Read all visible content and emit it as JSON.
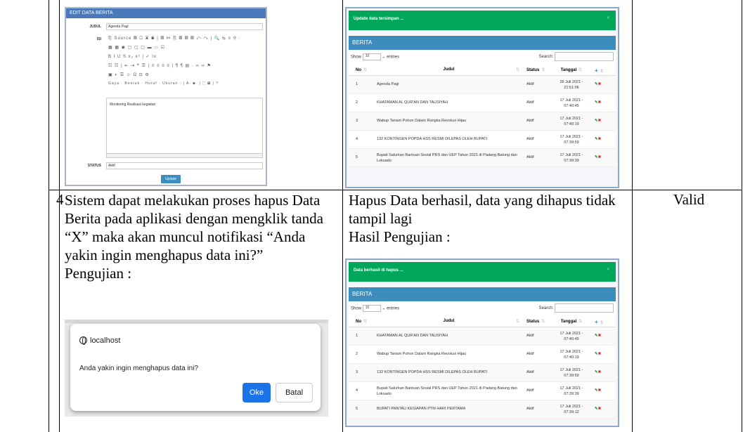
{
  "row4": {
    "number": "4",
    "description": "Sistem dapat melakukan proses hapus Data Berita pada aplikasi dengan mengklik tanda “X” maka akan muncul notifikasi “Anda yakin ingin menghapus data ini?”",
    "testing_label": "Pengujian :",
    "expected": "Hapus Data berhasil, data yang dihapus tidak tampil lagi",
    "result_label": "Hasil Pengujian :",
    "status": "Valid"
  },
  "editor": {
    "title": "EDIT DATA BERITA",
    "judul_label": "JUDUL",
    "judul_value": "Agenda Pagi",
    "isi_label": "ISI",
    "toolbar_row1": "⎘ Source  ▤ ▢ ▣ ◉ | ▤ ✂ ⎘ ▤ ▤ ▤ ↶ ↷ | 🔍 ⇆ ≡ ⚲ ·",
    "toolbar_row2": "▦ ▦ ◉ ▢ ▢ ▢ ▬ ▭ ☑",
    "toolbar_row3": "B  I  U  S  x₂  x²  | ✓  Ix",
    "toolbar_row4": "☷ ☷ | ⇤ ⇥ ❝ ☰ | ≡ ≡ ≡ ≡ | ¶ ¶ ▤ · ∞ ∞ ⚑",
    "toolbar_row5": "▣ ◐ ☰ ☺ Ω ⊡ ⚙",
    "toolbar_row6": "Gaya   ·  Bentuk  ·  Huruf  ·  Ukuran  · | A· ◙· | ⛶ ▤ | ?",
    "content": "Monitoring Realisasi kegiatan",
    "status_label": "STATUS",
    "status_value": "Aktif",
    "update_button": "Update"
  },
  "table_top": {
    "alert": "Update data tersimpan ...",
    "alert_close": "×",
    "box_title": "BERITA",
    "show_label": "Show",
    "show_value": "10",
    "entries_label": "entries",
    "search_label": "Search:",
    "headers": {
      "no": "No",
      "judul": "Judul",
      "status": "Status",
      "tanggal": "Tanggal",
      "add": "+"
    },
    "rows": [
      {
        "no": "1",
        "judul": "Agenda Pagi",
        "status": "Aktif",
        "tanggal": "26 Juli 2021 - 21:51:06"
      },
      {
        "no": "2",
        "judul": "KHATAMAN AL QUR'AN DAN TAUSIYAH",
        "status": "Aktif",
        "tanggal": "17 Juli 2021 - 07:40:45"
      },
      {
        "no": "3",
        "judul": "Wabup Tanam Pohon Dalam Rangka Revolusi Hijau",
        "status": "Aktif",
        "tanggal": "17 Juli 2021 - 07:40:19"
      },
      {
        "no": "4",
        "judul": "132 KONTINGEN POPDA HSS RESMI DILEPAS OLEH BUPATI",
        "status": "Aktif",
        "tanggal": "17 Juli 2021 - 07:39:59"
      },
      {
        "no": "5",
        "judul": "Bupati Salurkan Bantuan Sosial PRS dan UEP Tahun 2021 di Padang Batung dan Loksado",
        "status": "Aktif",
        "tanggal": "17 Juli 2021 - 07:39:39"
      }
    ]
  },
  "table_bottom": {
    "alert": "Data berhasil di hapus ...",
    "alert_close": "×",
    "box_title": "BERITA",
    "show_label": "Show",
    "show_value": "10",
    "entries_label": "entries",
    "search_label": "Search:",
    "headers": {
      "no": "No",
      "judul": "Judul",
      "status": "Status",
      "tanggal": "Tanggal",
      "add": "+"
    },
    "rows": [
      {
        "no": "1",
        "judul": "KHATAMAN AL QUR'AN DAN TAUSIYAH",
        "status": "Aktif",
        "tanggal": "17 Juli 2021 - 07:40:45"
      },
      {
        "no": "2",
        "judul": "Wabup Tanam Pohon Dalam Rangka Revolusi Hijau",
        "status": "Aktif",
        "tanggal": "17 Juli 2021 - 07:40:19"
      },
      {
        "no": "3",
        "judul": "132 KONTINGEN POPDA HSS RESMI DILEPAS OLEH BUPATI",
        "status": "Aktif",
        "tanggal": "17 Juli 2021 - 07:39:59"
      },
      {
        "no": "4",
        "judul": "Bupati Salurkan Bantuan Sosial PRS dan UEP Tahun 2021 di Padang Batung dan Loksado",
        "status": "Aktif",
        "tanggal": "17 Juli 2021 - 07:39:39"
      },
      {
        "no": "5",
        "judul": "BUPATI PANTAU KESIAPAN PTM HARI PERTAMA",
        "status": "Aktif",
        "tanggal": "17 Juli 2021 - 07:39:12"
      }
    ]
  },
  "dialog": {
    "host": "localhost",
    "message": "Anda yakin ingin menghapus data ini?",
    "ok": "Oke",
    "cancel": "Batal"
  },
  "icons": {
    "sort": "⇅",
    "edit": "✎",
    "delete": "✖"
  },
  "colors": {
    "alert_green": "#00a65a",
    "box_blue": "#3c8dbc",
    "dialog_ok_blue": "#1a73e8"
  }
}
